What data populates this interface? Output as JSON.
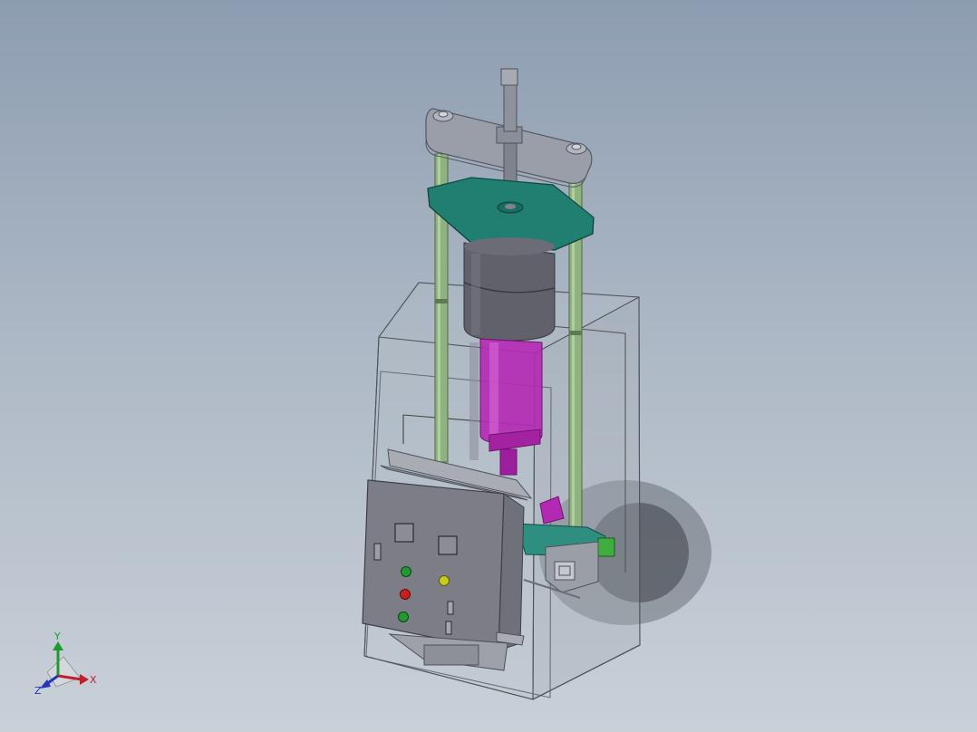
{
  "triad": {
    "x_label": "X",
    "y_label": "Y",
    "z_label": "Z",
    "x_color": "#c0202a",
    "y_color": "#1e9a2e",
    "z_color": "#2436b8"
  },
  "colors": {
    "background_top": "#8d9db1",
    "background_bottom": "#c9d0d8",
    "steel": "#8f929c",
    "guide_rod": "#8fb37e",
    "top_plate": "#1f7d70",
    "cylinder": "#5a5a64",
    "piston": "#b828b8",
    "control_box": "#7a7a82",
    "lamp_green": "#1e9a2e",
    "lamp_red": "#c81e1e",
    "lamp_yellow": "#c8c81e"
  },
  "icons": [
    "coordinate-triad-icon"
  ]
}
